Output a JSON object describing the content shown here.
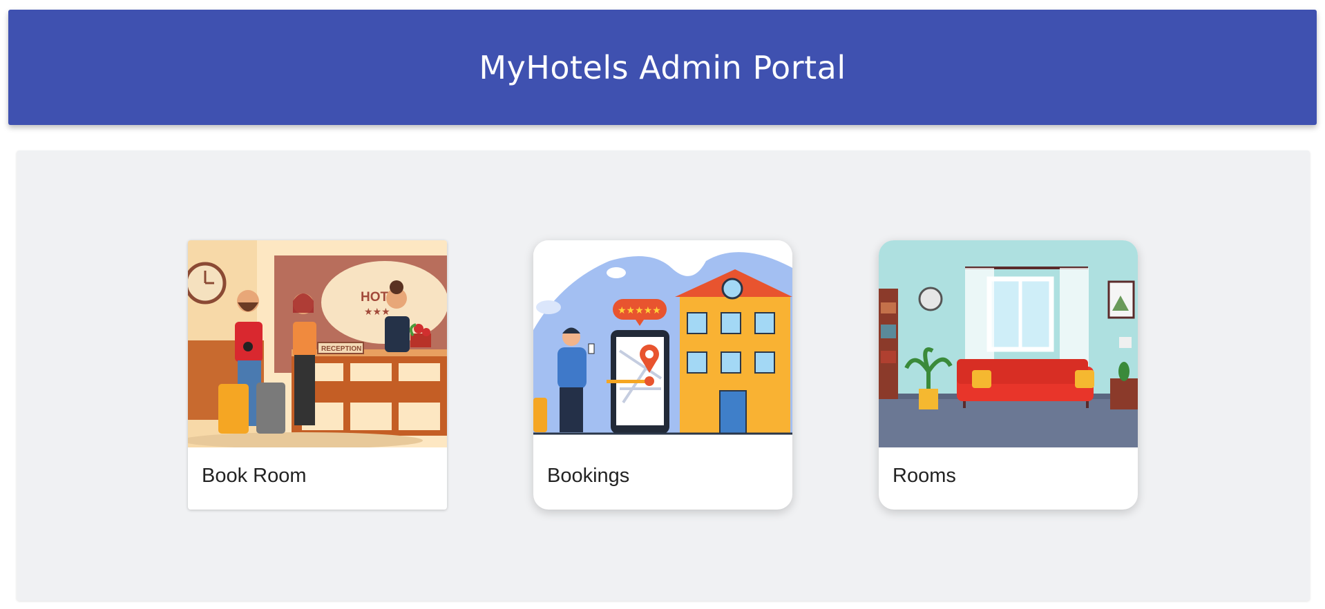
{
  "header": {
    "title": "MyHotels Admin Portal"
  },
  "cards": [
    {
      "label": "Book Room",
      "illustration": "hotel-reception-illustration",
      "hotel_sign": "HOTEL",
      "desk_sign": "RECEPTION"
    },
    {
      "label": "Bookings",
      "illustration": "mobile-booking-illustration",
      "rating_stars": "★★★★★"
    },
    {
      "label": "Rooms",
      "illustration": "living-room-illustration"
    }
  ],
  "colors": {
    "header_bg": "#3f51b0",
    "panel_bg": "#f0f1f3",
    "card_bg": "#ffffff",
    "label_text": "#222222"
  }
}
